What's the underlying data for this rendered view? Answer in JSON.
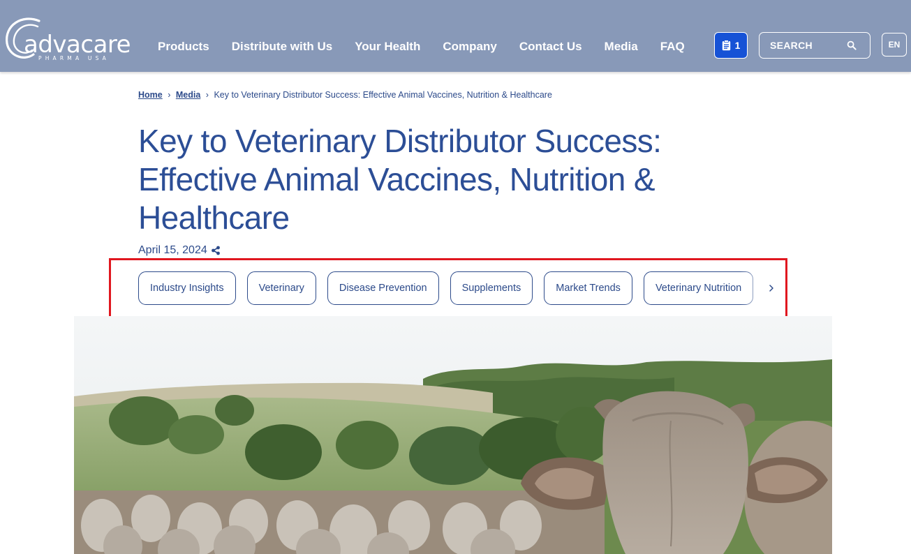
{
  "header": {
    "logo": {
      "word": "advacare",
      "sub": "PHARMA USA"
    },
    "nav": [
      "Products",
      "Distribute with Us",
      "Your Health",
      "Company",
      "Contact Us",
      "Media",
      "FAQ"
    ],
    "cart_count": "1",
    "search_label": "SEARCH",
    "lang": "EN",
    "colors": {
      "bar": "#8899b8",
      "cart": "#1652d6"
    }
  },
  "breadcrumb": {
    "home": "Home",
    "media": "Media",
    "separator": "›",
    "current": "Key to Veterinary Distributor Success: Effective Animal Vaccines, Nutrition & Healthcare"
  },
  "article": {
    "title": "Key to Veterinary Distributor Success: Effective Animal Vaccines, Nutrition & Healthcare",
    "date": "April 15, 2024"
  },
  "tags": [
    "Industry Insights",
    "Veterinary",
    "Disease Prevention",
    "Supplements",
    "Market Trends",
    "Veterinary Nutrition"
  ],
  "icons": {
    "cart": "clipboard-icon",
    "search": "search-icon",
    "share": "share-icon",
    "next": "chevron-right-icon"
  },
  "highlight_color": "#e0171f"
}
